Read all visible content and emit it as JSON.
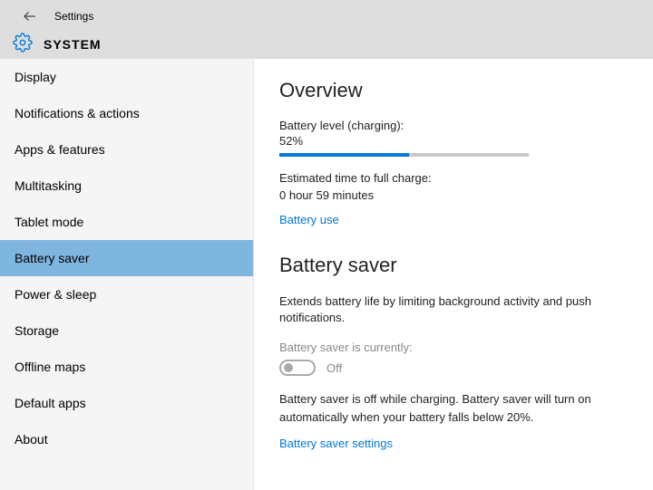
{
  "header": {
    "title_small": "Settings",
    "title_main": "SYSTEM"
  },
  "sidebar": {
    "items": [
      {
        "label": "Display",
        "selected": false
      },
      {
        "label": "Notifications & actions",
        "selected": false
      },
      {
        "label": "Apps & features",
        "selected": false
      },
      {
        "label": "Multitasking",
        "selected": false
      },
      {
        "label": "Tablet mode",
        "selected": false
      },
      {
        "label": "Battery saver",
        "selected": true
      },
      {
        "label": "Power & sleep",
        "selected": false
      },
      {
        "label": "Storage",
        "selected": false
      },
      {
        "label": "Offline maps",
        "selected": false
      },
      {
        "label": "Default apps",
        "selected": false
      },
      {
        "label": "About",
        "selected": false
      }
    ]
  },
  "overview": {
    "title": "Overview",
    "battery_level_label": "Battery level (charging):",
    "battery_level_value": "52%",
    "battery_level_percent": 52,
    "est_label": "Estimated time to full charge:",
    "est_value": "0 hour 59 minutes",
    "battery_use_link": "Battery use"
  },
  "battery_saver": {
    "title": "Battery saver",
    "description": "Extends battery life by limiting background activity and push notifications.",
    "currently_label": "Battery saver is currently:",
    "toggle_state": "Off",
    "note": "Battery saver is off while charging. Battery saver will turn on automatically when your battery falls below 20%.",
    "settings_link": "Battery saver settings"
  }
}
